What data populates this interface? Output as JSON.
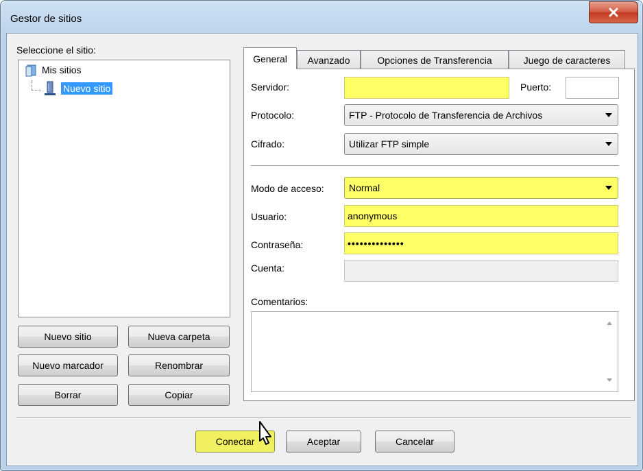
{
  "window": {
    "title": "Gestor de sitios",
    "close_label": "x"
  },
  "site_panel": {
    "select_label": "Seleccione el sitio:",
    "tree": [
      {
        "label": "Mis sitios",
        "icon": "folder-icon"
      },
      {
        "label": "Nuevo sitio",
        "icon": "server-icon",
        "selected": true
      }
    ],
    "buttons": {
      "new_site": "Nuevo sitio",
      "new_folder": "Nueva carpeta",
      "new_bookmark": "Nuevo marcador",
      "rename": "Renombrar",
      "delete": "Borrar",
      "copy": "Copiar"
    }
  },
  "tabs": [
    {
      "label": "General",
      "active": true
    },
    {
      "label": "Avanzado",
      "active": false
    },
    {
      "label": "Opciones de Transferencia",
      "active": false
    },
    {
      "label": "Juego de caracteres",
      "active": false
    }
  ],
  "general": {
    "server_label": "Servidor:",
    "server_value": "",
    "port_label": "Puerto:",
    "port_value": "",
    "protocol_label": "Protocolo:",
    "protocol_value": "FTP - Protocolo de Transferencia de Archivos",
    "encryption_label": "Cifrado:",
    "encryption_value": "Utilizar FTP simple",
    "logon_label": "Modo de acceso:",
    "logon_value": "Normal",
    "user_label": "Usuario:",
    "user_value": "anonymous",
    "password_label": "Contraseña:",
    "password_value": "••••••••••••••",
    "account_label": "Cuenta:",
    "account_value": "",
    "comments_label": "Comentarios:",
    "comments_value": ""
  },
  "footer": {
    "connect": "Conectar",
    "ok": "Aceptar",
    "cancel": "Cancelar"
  },
  "colors": {
    "highlight_yellow": "#ffff66",
    "selection_blue": "#3399ff",
    "close_red": "#c23a21"
  }
}
